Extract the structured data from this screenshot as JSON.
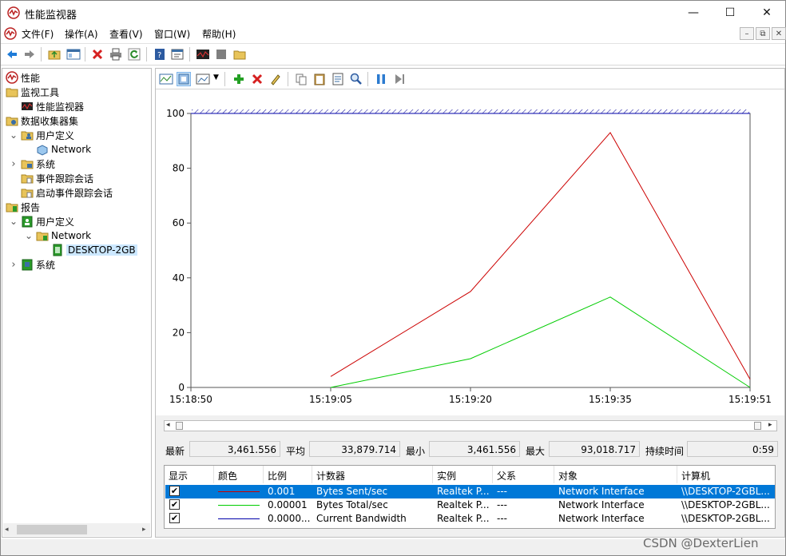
{
  "window": {
    "title": "性能监视器",
    "controls": {
      "minimize": "—",
      "maximize": "☐",
      "close": "✕"
    }
  },
  "menubar": {
    "items": [
      "文件(F)",
      "操作(A)",
      "查看(V)",
      "窗口(W)",
      "帮助(H)"
    ]
  },
  "tree": {
    "items": [
      {
        "label": "性能",
        "icon": "perf-monitor-icon"
      },
      {
        "label": "监视工具",
        "icon": "folder-icon"
      },
      {
        "label": "性能监视器",
        "icon": "perf-graph-icon"
      },
      {
        "label": "数据收集器集",
        "icon": "collector-set-icon"
      },
      {
        "label": "用户定义",
        "icon": "user-folder-icon"
      },
      {
        "label": "Network",
        "icon": "collector-icon"
      },
      {
        "label": "系统",
        "icon": "system-folder-icon"
      },
      {
        "label": "事件跟踪会话",
        "icon": "trace-folder-icon"
      },
      {
        "label": "启动事件跟踪会话",
        "icon": "trace-folder-icon"
      },
      {
        "label": "报告",
        "icon": "report-icon"
      },
      {
        "label": "用户定义",
        "icon": "report-user-icon"
      },
      {
        "label": "Network",
        "icon": "report-folder-icon"
      },
      {
        "label": "DESKTOP-2GB",
        "icon": "report-doc-icon"
      },
      {
        "label": "系统",
        "icon": "report-system-icon"
      }
    ]
  },
  "graph": {
    "y_ticks": [
      "100",
      "80",
      "60",
      "40",
      "20",
      "0"
    ],
    "x_ticks": [
      "15:18:50",
      "15:19:05",
      "15:19:20",
      "15:19:35",
      "15:19:51"
    ]
  },
  "chart_data": {
    "type": "line",
    "ylim": [
      0,
      100
    ],
    "x": [
      "15:18:50",
      "15:19:05",
      "15:19:20",
      "15:19:35",
      "15:19:51"
    ],
    "series": [
      {
        "name": "Bytes Sent/sec",
        "color": "#cc0000",
        "points": [
          [
            1,
            4
          ],
          [
            2,
            35
          ],
          [
            3,
            93
          ],
          [
            4,
            3
          ]
        ]
      },
      {
        "name": "Bytes Total/sec",
        "color": "#00cc00",
        "points": [
          [
            1,
            0
          ],
          [
            2,
            10.5
          ],
          [
            3,
            33
          ],
          [
            4,
            0
          ]
        ]
      },
      {
        "name": "Current Bandwidth",
        "color": "#0000aa",
        "points": [
          [
            0,
            100
          ],
          [
            4,
            100
          ]
        ]
      }
    ]
  },
  "stats": {
    "last_label": "最新",
    "last_value": "3,461.556",
    "avg_label": "平均",
    "avg_value": "33,879.714",
    "min_label": "最小",
    "min_value": "3,461.556",
    "max_label": "最大",
    "max_value": "93,018.717",
    "dur_label": "持续时间",
    "dur_value": "0:59"
  },
  "legend": {
    "headers": [
      "显示",
      "颜色",
      "比例",
      "计数器",
      "实例",
      "父系",
      "对象",
      "计算机"
    ],
    "rows": [
      {
        "show": "✔",
        "color": "#cc0000",
        "scale": "0.001",
        "counter": "Bytes Sent/sec",
        "instance": "Realtek P...",
        "parent": "---",
        "object": "Network Interface",
        "computer": "\\\\DESKTOP-2GBL..."
      },
      {
        "show": "✔",
        "color": "#00cc00",
        "scale": "0.00001",
        "counter": "Bytes Total/sec",
        "instance": "Realtek P...",
        "parent": "---",
        "object": "Network Interface",
        "computer": "\\\\DESKTOP-2GBL..."
      },
      {
        "show": "✔",
        "color": "#0000aa",
        "scale": "0.0000...",
        "counter": "Current Bandwidth",
        "instance": "Realtek P...",
        "parent": "---",
        "object": "Network Interface",
        "computer": "\\\\DESKTOP-2GBL..."
      }
    ]
  },
  "watermark": "CSDN @DexterLien"
}
